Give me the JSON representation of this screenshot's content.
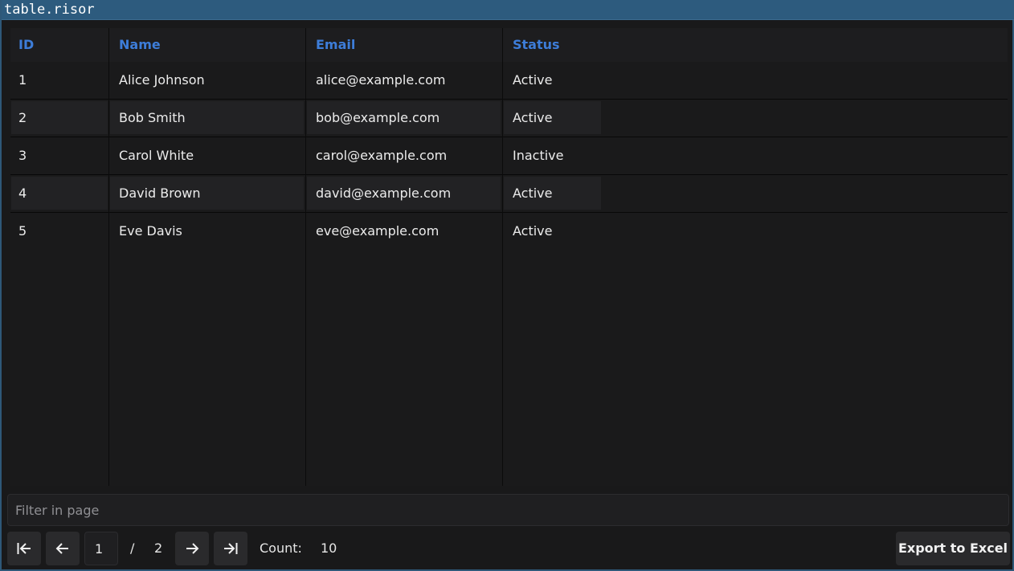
{
  "window": {
    "title": "table.risor"
  },
  "table": {
    "columns": [
      "ID",
      "Name",
      "Email",
      "Status"
    ],
    "rows": [
      {
        "id": "1",
        "name": "Alice Johnson",
        "email": "alice@example.com",
        "status": "Active"
      },
      {
        "id": "2",
        "name": "Bob Smith",
        "email": "bob@example.com",
        "status": "Active"
      },
      {
        "id": "3",
        "name": "Carol White",
        "email": "carol@example.com",
        "status": "Inactive"
      },
      {
        "id": "4",
        "name": "David Brown",
        "email": "david@example.com",
        "status": "Active"
      },
      {
        "id": "5",
        "name": "Eve Davis",
        "email": "eve@example.com",
        "status": "Active"
      }
    ]
  },
  "filter": {
    "placeholder": "Filter in page"
  },
  "pagination": {
    "current_page": "1",
    "separator": "/",
    "total_pages": "2",
    "count_label": "Count:",
    "count_value": "10",
    "icons": [
      "first-page-icon",
      "prev-page-icon",
      "next-page-icon",
      "last-page-icon"
    ]
  },
  "actions": {
    "export_label": "Export to Excel"
  },
  "colors": {
    "titlebar": "#2d5b7e",
    "header_text": "#3d7dd9",
    "background": "#1a1a1b"
  }
}
